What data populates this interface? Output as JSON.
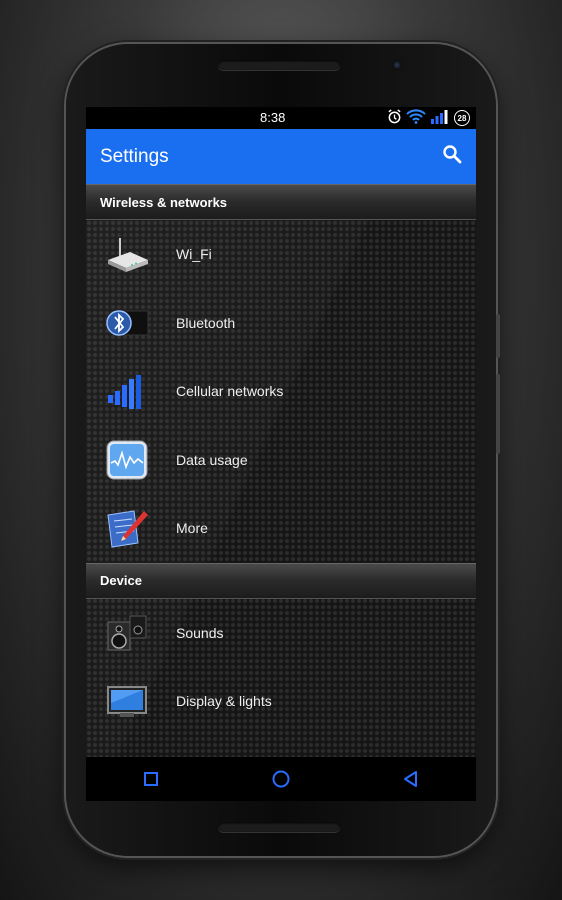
{
  "status_bar": {
    "time": "8:38",
    "battery_level": "28",
    "icons": [
      "alarm-icon",
      "wifi-icon",
      "signal-icon",
      "battery-icon"
    ]
  },
  "app_bar": {
    "title": "Settings",
    "search_icon": "search-icon",
    "color": "#1a6ff0"
  },
  "sections": [
    {
      "header": "Wireless & networks",
      "items": [
        {
          "label": "Wi_Fi",
          "icon": "router-icon"
        },
        {
          "label": "Bluetooth",
          "icon": "bluetooth-icon"
        },
        {
          "label": "Cellular networks",
          "icon": "cellular-signal-icon"
        },
        {
          "label": "Data usage",
          "icon": "data-usage-chart-icon"
        },
        {
          "label": "More",
          "icon": "pencil-note-icon"
        }
      ]
    },
    {
      "header": "Device",
      "items": [
        {
          "label": "Sounds",
          "icon": "speaker-icon"
        },
        {
          "label": "Display & lights",
          "icon": "display-monitor-icon"
        }
      ]
    }
  ],
  "nav_bar": {
    "icons": [
      "recent-apps-icon",
      "home-icon",
      "back-icon"
    ],
    "color": "#2a6cff"
  }
}
